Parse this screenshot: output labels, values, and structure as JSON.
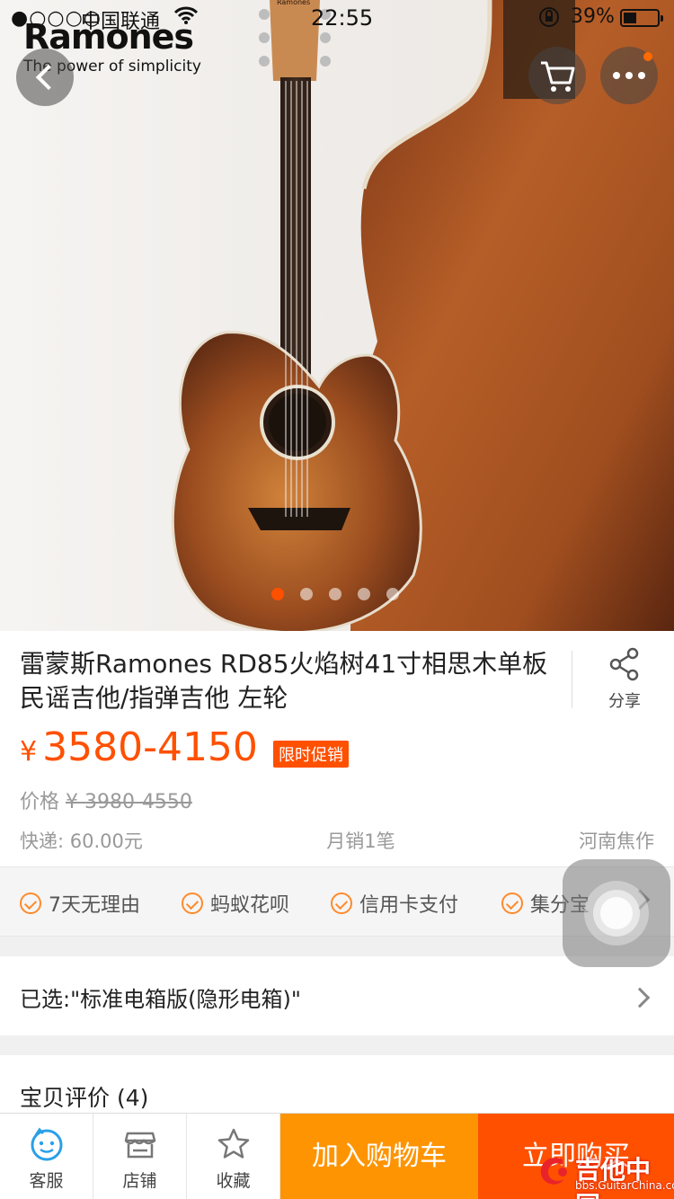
{
  "status_bar": {
    "signal": "●○○○○",
    "carrier": "中国联通",
    "time": "22:55",
    "battery_percent": "39%"
  },
  "image_overlay": {
    "brand_name": "Ramones",
    "brand_tagline": "The power of simplicity",
    "headstock_logo": "Ramones",
    "carousel_total": 5,
    "carousel_active": 0
  },
  "product": {
    "title": "雷蒙斯Ramones RD85火焰树41寸相思木单板民谣吉他/指弹吉他 左轮",
    "share_label": "分享",
    "price_currency": "¥",
    "price_range": "3580-4150",
    "promo_badge": "限时促销",
    "old_price_label": "价格",
    "old_price": "¥ 3980-4550",
    "shipping": "快递: 60.00元",
    "monthly_sales": "月销1笔",
    "location": "河南焦作"
  },
  "guarantees": [
    "7天无理由",
    "蚂蚁花呗",
    "信用卡支付",
    "集分宝"
  ],
  "selection": {
    "text": "已选:\"标准电箱版(隐形电箱)\""
  },
  "reviews": {
    "title": "宝贝评价 (4)"
  },
  "bottom_bar": {
    "service_label": "客服",
    "shop_label": "店铺",
    "favorite_label": "收藏",
    "add_to_cart": "加入购物车",
    "buy_now": "立即购买"
  },
  "watermark": {
    "text": "吉他中国",
    "url": "bbs.GuitarChina.com"
  },
  "colors": {
    "accent": "#ff5000",
    "cart_button": "#ff9402",
    "check": "#ff8a2b"
  }
}
